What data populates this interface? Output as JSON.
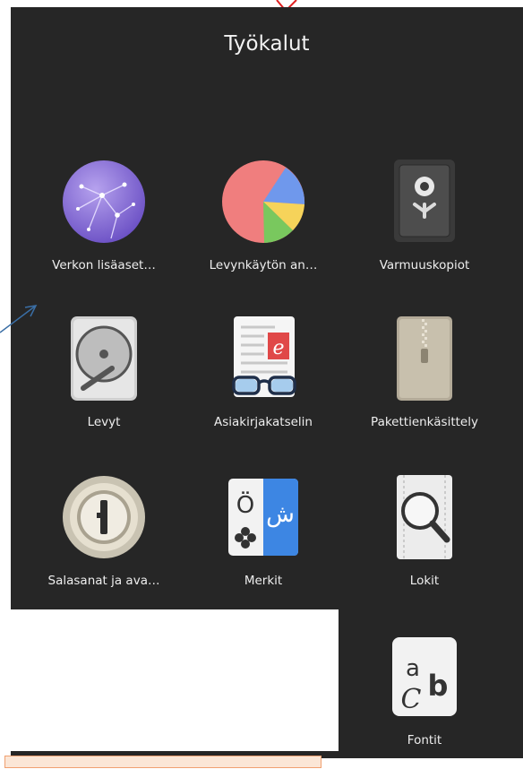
{
  "folder": {
    "title": "Työkalut"
  },
  "apps": [
    {
      "name": "network",
      "label": "Verkon lisäaset…",
      "icon": "globe-icon"
    },
    {
      "name": "disk-usage",
      "label": "Levynkäytön an…",
      "icon": "pie-chart-icon"
    },
    {
      "name": "backups",
      "label": "Varmuuskopiot",
      "icon": "safe-icon"
    },
    {
      "name": "disks",
      "label": "Levyt",
      "icon": "hard-disk-icon"
    },
    {
      "name": "document-viewer",
      "label": "Asiakirjakatselin",
      "icon": "document-glasses-icon"
    },
    {
      "name": "archive-manager",
      "label": "Pakettienkäsittely",
      "icon": "zip-archive-icon"
    },
    {
      "name": "passwords",
      "label": "Salasanat ja ava…",
      "icon": "keyhole-lock-icon"
    },
    {
      "name": "characters",
      "label": "Merkit",
      "icon": "characters-icon"
    },
    {
      "name": "logs",
      "label": "Lokit",
      "icon": "magnifier-log-icon"
    },
    {
      "name": "fonts",
      "label": "Fontit",
      "icon": "font-icon"
    }
  ],
  "glyphs": {
    "characters_o_umlaut": "Ö",
    "characters_arabic": "ش",
    "font_a": "a",
    "font_c": "C",
    "font_b": "b"
  },
  "colors": {
    "folder_bg": "#262626",
    "label": "#eeeeee",
    "arrow_red": "#e02020",
    "arrow_blue": "#3a6ea5"
  }
}
